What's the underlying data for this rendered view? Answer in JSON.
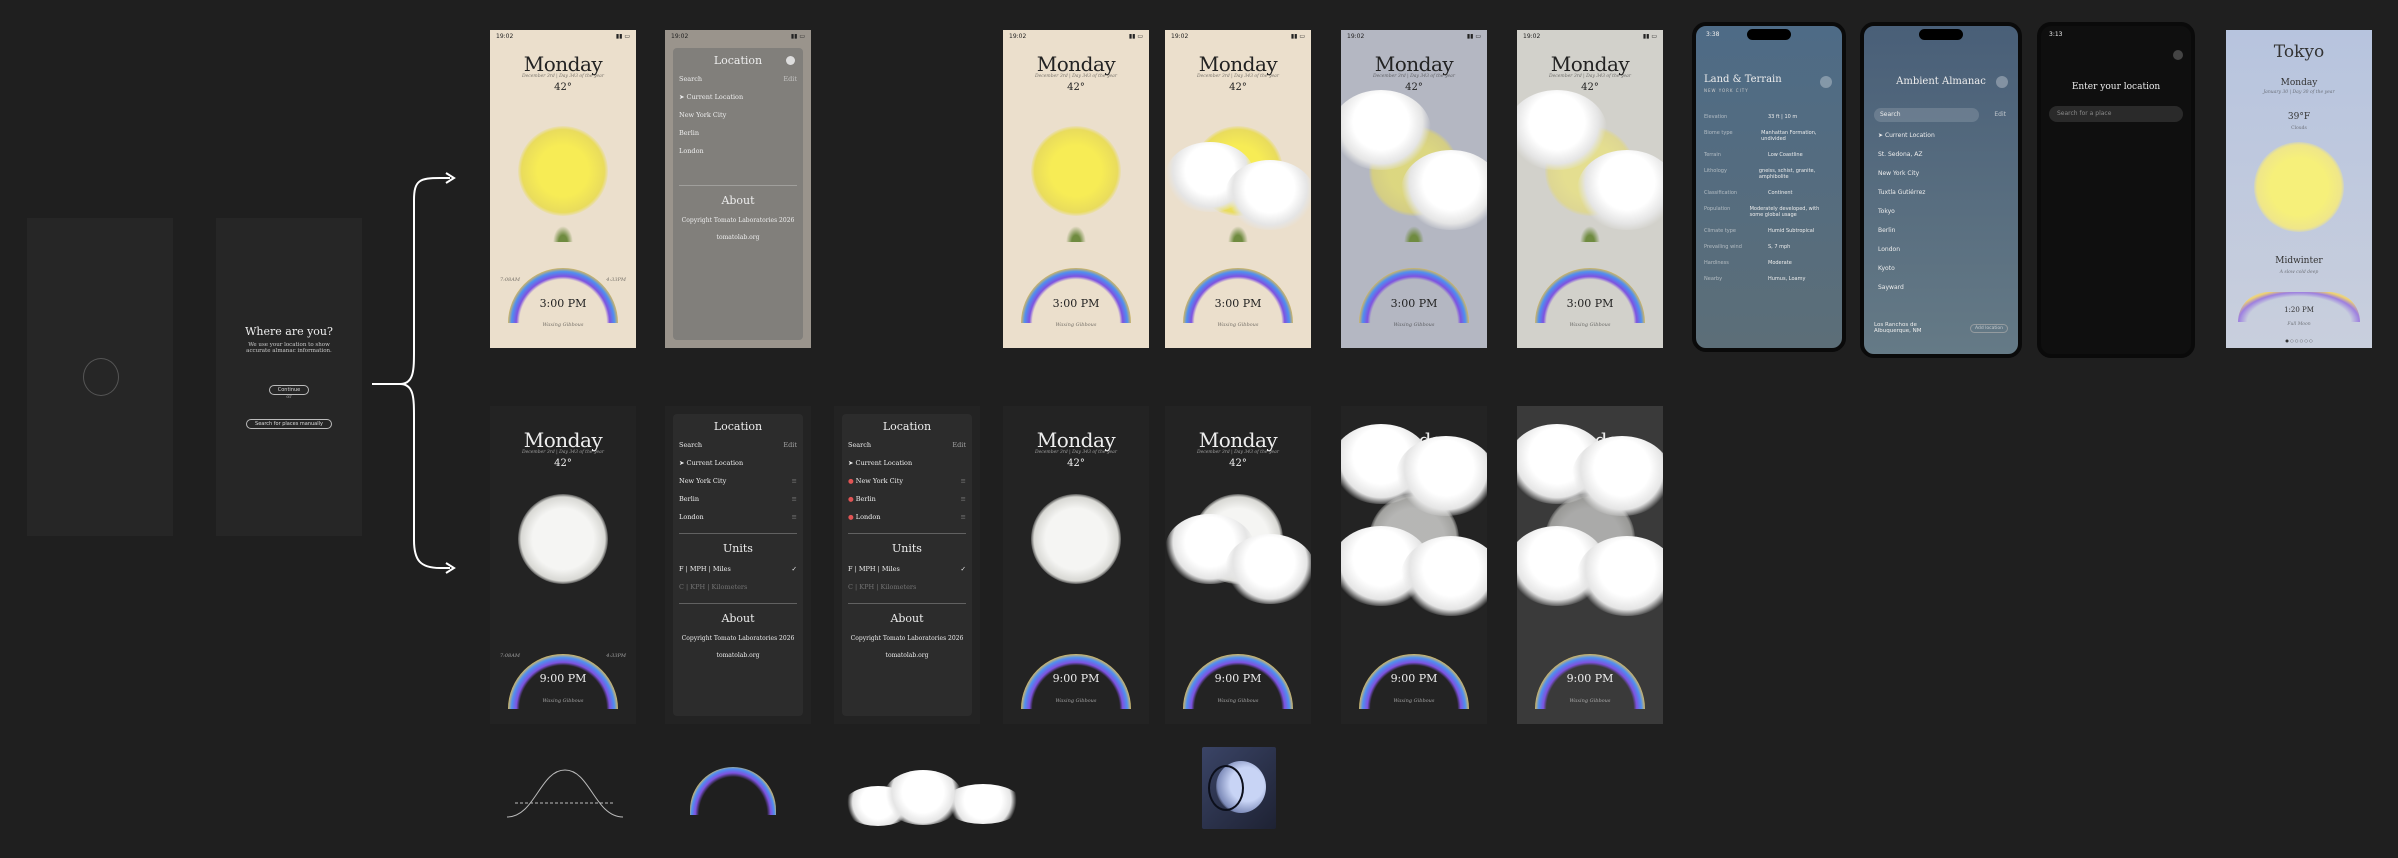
{
  "status_time": "19:02",
  "day": "Monday",
  "date_line": "December 3rd  |  Day 343 of the year",
  "temp": "42°",
  "day_time": "3:00 PM",
  "night_time": "9:00 PM",
  "moon_phase": "Waxing Gibbous",
  "sunrise_label": "7:08AM",
  "sunset_label": "4:33PM",
  "onboarding": {
    "title": "Where are you?",
    "body": "We use your location to show accurate almanac information.",
    "allow_button": "Continue",
    "or": "or",
    "manual_button": "Search for places manually"
  },
  "menu_light": {
    "title": "Location",
    "search": "Search",
    "edit": "Edit",
    "items": [
      "Current Location",
      "New York City",
      "Berlin",
      "London"
    ],
    "about_title": "About",
    "copyright": "Copyright Tomato Laboratories 2026",
    "site": "tomatolab.org"
  },
  "menu_dark": {
    "title": "Location",
    "search": "Search",
    "edit": "Edit",
    "items": [
      "Current Location",
      "New York City",
      "Berlin",
      "London"
    ],
    "units_title": "Units",
    "unit_1": "F  |  MPH  |  Miles",
    "unit_2": "C  |  KPH  |  Kilometers",
    "about_title": "About",
    "copyright": "Copyright Tomato Laboratories 2026",
    "site": "tomatolab.org"
  },
  "land": {
    "status_time": "3:38",
    "title": "Land & Terrain",
    "subtitle": "NEW YORK CITY",
    "rows": [
      [
        "Elevation",
        "33 ft  |  10 m"
      ],
      [
        "Biome type",
        "Manhattan Formation, undivided"
      ],
      [
        "Terrain",
        "Low Coastline"
      ],
      [
        "Lithology",
        "gneiss, schist, granite, amphibolite"
      ],
      [
        "Classification",
        "Continent"
      ],
      [
        "Population",
        "Moderately developed, with some global usage"
      ],
      [
        "Climate type",
        "Humid Subtropical"
      ],
      [
        "Prevailing wind",
        "S, 7 mph"
      ],
      [
        "Hardiness",
        "Moderate"
      ],
      [
        "Nearby",
        "Humus, Loamy"
      ]
    ]
  },
  "ambient": {
    "title": "Ambient Almanac",
    "search": "Search",
    "edit": "Edit",
    "items": [
      "Current Location",
      "St. Sedona, AZ",
      "New York City",
      "Tuxtla Gutiérrez",
      "Tokyo",
      "Berlin",
      "London",
      "Kyoto",
      "Sayward"
    ],
    "footer_place": "Los Ranchos de Albuquerque, NM",
    "footer_button": "Add location"
  },
  "enter": {
    "status_time": "3:13",
    "title": "Enter your location",
    "placeholder": "Search for a place"
  },
  "tokyo": {
    "city": "Tokyo",
    "day": "Monday",
    "date_line": "January 30  |  Day 30 of the year",
    "temp": "39°F",
    "cond": "Clouds",
    "season": "Midwinter",
    "season_sub": "A slow cold deep",
    "time": "1:20 PM",
    "moon": "Full Moon"
  },
  "colors": {
    "background": "#1f1f1f",
    "paper": "#ebdfcc",
    "night": "#232323",
    "sun": "#f7ec55",
    "arrow": "#ffffff"
  }
}
